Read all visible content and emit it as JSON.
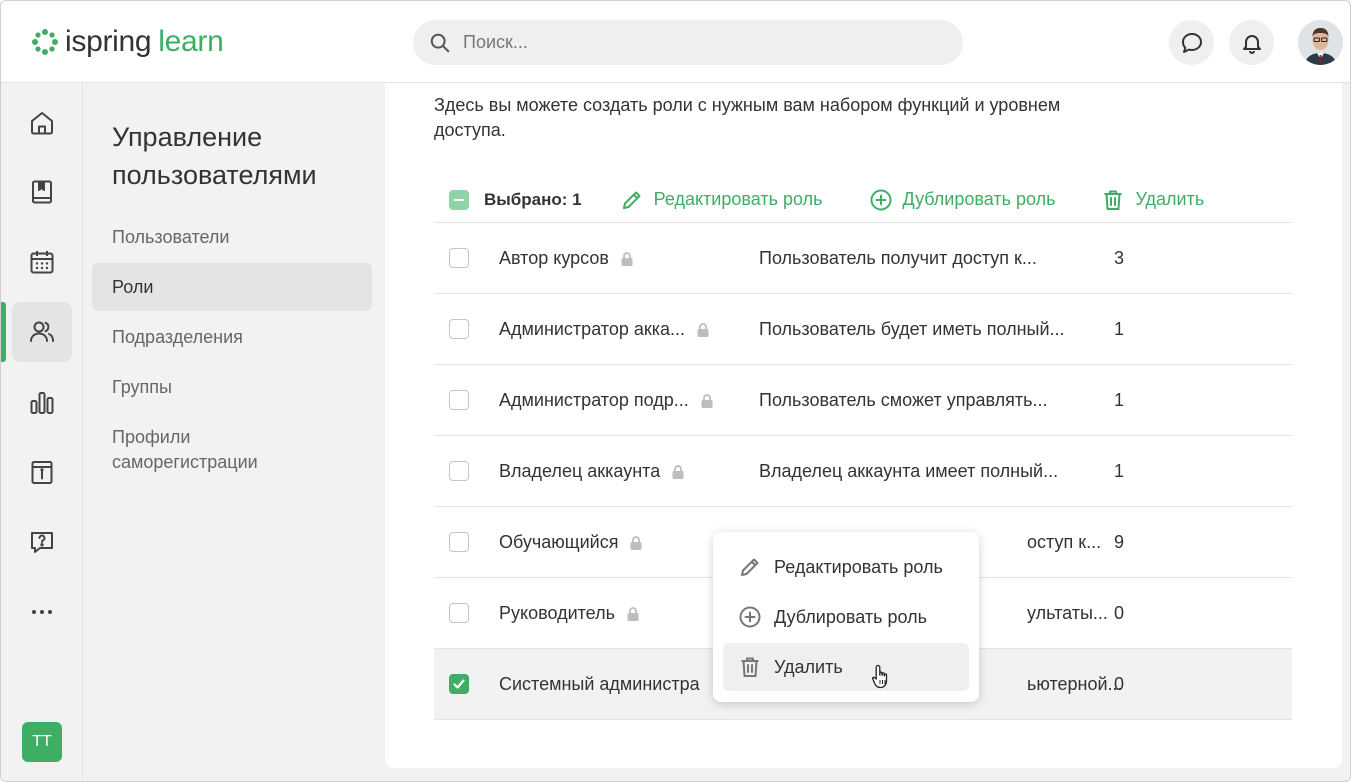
{
  "header": {
    "logo_word1": "ispring",
    "logo_word2": "learn",
    "search_placeholder": "Поиск...",
    "icons": [
      "search-icon",
      "chat-icon",
      "bell-icon"
    ],
    "brand_color": "#3dae63"
  },
  "rail": {
    "items": [
      "home-icon",
      "book-icon",
      "calendar-icon",
      "users-icon",
      "bar-chart-icon",
      "info-board-icon",
      "help-icon",
      "more-icon"
    ],
    "active": "users-icon",
    "user_initials": "ТТ"
  },
  "sidebar": {
    "title": "Управление пользователями",
    "items": [
      {
        "label": "Пользователи"
      },
      {
        "label": "Роли"
      },
      {
        "label": "Подразделения"
      },
      {
        "label": "Группы"
      },
      {
        "label": "Профили саморегистрации"
      }
    ],
    "active": "Роли"
  },
  "main": {
    "intro": "Здесь вы можете создать роли с нужным вам набором функций и уровнем доступа.",
    "toolbar": {
      "selected": "Выбрано: 1",
      "edit": "Редактировать роль",
      "duplicate": "Дублировать роль",
      "delete": "Удалить"
    },
    "rows": [
      {
        "name": "Автор курсов",
        "desc": "Пользователь получит доступ к...",
        "count": "3",
        "checked": false
      },
      {
        "name": "Администратор акка...",
        "desc": "Пользователь будет иметь полный...",
        "count": "1",
        "checked": false
      },
      {
        "name": "Администратор подр...",
        "desc": "Пользователь сможет управлять...",
        "count": "1",
        "checked": false
      },
      {
        "name": "Владелец аккаунта",
        "desc": "Владелец аккаунта имеет полный...",
        "count": "1",
        "checked": false
      },
      {
        "name": "Обучающийся",
        "desc": "оступ к...",
        "count": "9",
        "checked": false
      },
      {
        "name": "Руководитель",
        "desc": "ультаты...",
        "count": "0",
        "checked": false
      },
      {
        "name": "Системный администра",
        "desc": "ьютерной...",
        "count": "0",
        "checked": true
      }
    ]
  },
  "context_menu": {
    "items": [
      {
        "label": "Редактировать роль",
        "icon": "pencil-icon"
      },
      {
        "label": "Дублировать роль",
        "icon": "plus-circle-icon"
      },
      {
        "label": "Удалить",
        "icon": "trash-icon"
      }
    ],
    "hovered": "Удалить"
  }
}
